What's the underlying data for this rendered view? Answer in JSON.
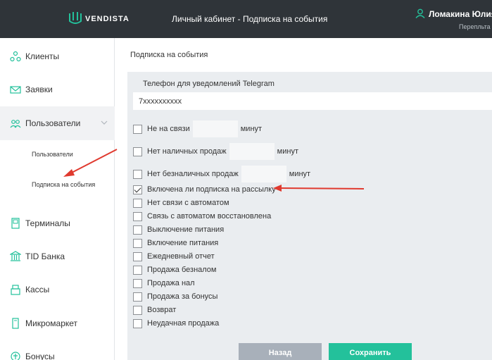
{
  "header": {
    "logo_text": "VENDISTA",
    "title": "Личный кабинет - Подписка на события",
    "user_name": "Ломакина Юлия Вя",
    "user_sub": "Перепльта п"
  },
  "sidebar": {
    "items": [
      {
        "label": "Клиенты",
        "icon": "clients-icon"
      },
      {
        "label": "Заявки",
        "icon": "mail-icon"
      },
      {
        "label": "Пользователи",
        "icon": "users-icon"
      },
      {
        "label": "Терминалы",
        "icon": "terminal-icon"
      },
      {
        "label": "TID Банка",
        "icon": "bank-icon"
      },
      {
        "label": "Кассы",
        "icon": "cashbox-icon"
      },
      {
        "label": "Микромаркет",
        "icon": "micromarket-icon"
      },
      {
        "label": "Бонусы",
        "icon": "bonus-icon"
      }
    ],
    "sub_items": [
      {
        "label": "Пользователи"
      },
      {
        "label": "Подписка на события"
      }
    ]
  },
  "main": {
    "page_title": "Подписка на события",
    "telegram_label": "Телефон для уведомлений Telegram",
    "telegram_value": "7xxxxxxxxxx",
    "minutes_label": "минут",
    "rows": [
      {
        "label": "Не на связи",
        "checked": false,
        "has_input": true
      },
      {
        "label": "Нет наличных продаж",
        "checked": false,
        "has_input": true
      },
      {
        "label": "Нет безналичных продаж",
        "checked": false,
        "has_input": true
      },
      {
        "label": "Включена ли подписка на рассылку",
        "checked": true
      },
      {
        "label": "Нет связи с автоматом",
        "checked": false
      },
      {
        "label": "Связь с автоматом восстановлена",
        "checked": false
      },
      {
        "label": "Выключение питания",
        "checked": false
      },
      {
        "label": "Включение питания",
        "checked": false
      },
      {
        "label": "Ежедневный отчет",
        "checked": false
      },
      {
        "label": "Продажа безналом",
        "checked": false
      },
      {
        "label": "Продажа нал",
        "checked": false
      },
      {
        "label": "Продажа за бонусы",
        "checked": false
      },
      {
        "label": "Возврат",
        "checked": false
      },
      {
        "label": "Неудачная продажа",
        "checked": false
      }
    ],
    "back_label": "Назад",
    "save_label": "Сохранить"
  },
  "colors": {
    "header_bg": "#2f3439",
    "accent": "#23c19b",
    "back_button": "#a8b0ba",
    "panel_bg": "#eaedf0",
    "annotation_arrow": "#e03a2f"
  }
}
